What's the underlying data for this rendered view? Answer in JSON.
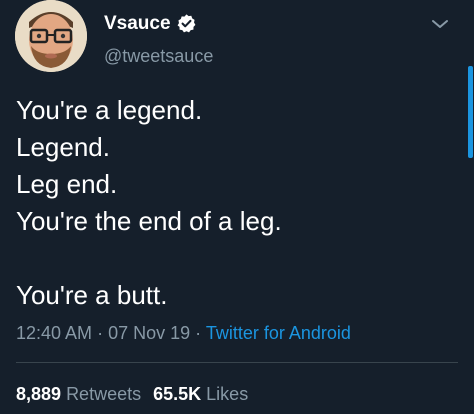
{
  "tweet": {
    "display_name": "Vsauce",
    "handle": "@tweetsauce",
    "verified_icon": "verified-badge-icon",
    "menu_icon": "chevron-down-icon",
    "body_lines": [
      "You're a legend.",
      "Legend.",
      "Leg end.",
      "You're the end of a leg.",
      "",
      "You're a butt."
    ],
    "time": "12:40 AM",
    "sep1": "·",
    "date": "07 Nov 19",
    "sep2": "·",
    "source": "Twitter for Android",
    "retweets_count": "8,889",
    "retweets_label": "Retweets",
    "likes_count": "65.5K",
    "likes_label": "Likes"
  },
  "colors": {
    "background": "#151f2b",
    "text": "#ffffff",
    "muted": "#8899a6",
    "accent": "#1b95e0",
    "divider": "#38444d"
  }
}
